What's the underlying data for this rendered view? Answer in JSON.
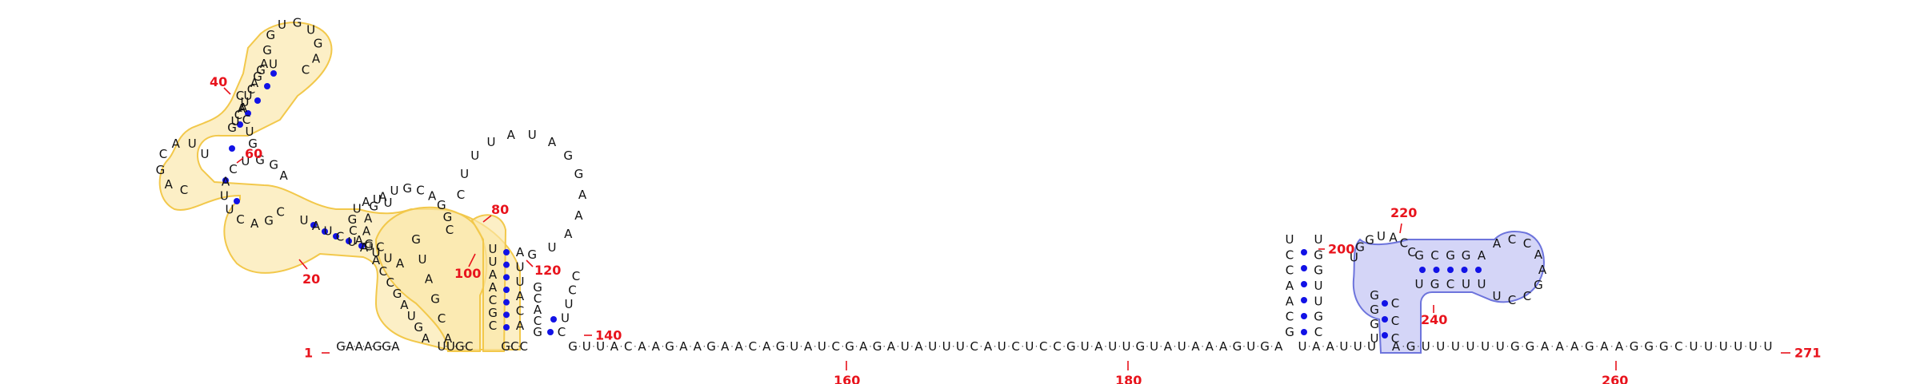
{
  "diagram": {
    "start_label": "1",
    "end_label": "271",
    "position_labels": [
      "20",
      "40",
      "60",
      "80",
      "100",
      "120",
      "140",
      "160",
      "180",
      "200",
      "220",
      "240",
      "260"
    ],
    "backbone_sequence": "GAAAGGAAUUGCGCCGUUACAAGAAGAACAGUAUCGAGAUAUUUCAUCUCCGUAUUGUAUAAAGUGAUAAUUUAGUUUUUUGGAAAGAAGGGCUUUUUU",
    "colors": {
      "label": "#e8131c",
      "base_pair": "#1212e6",
      "highlight_1": "#fbe6a8",
      "highlight_2": "#c9cbf5"
    }
  }
}
